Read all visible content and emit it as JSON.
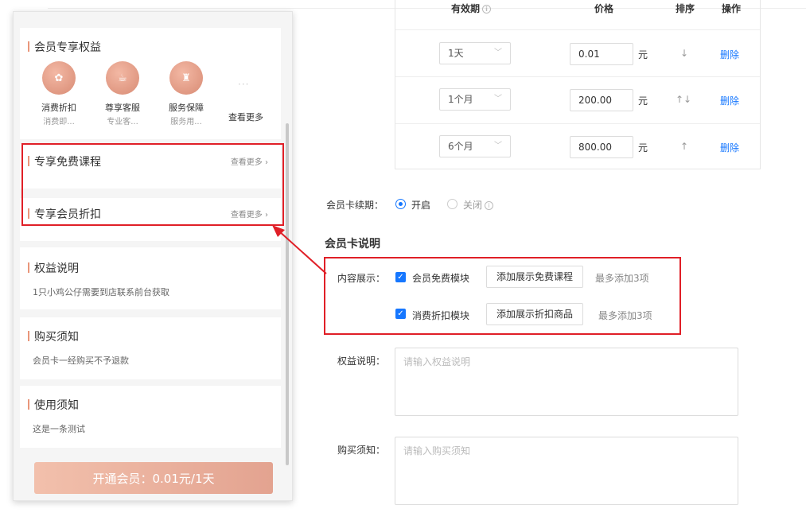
{
  "preview": {
    "benefits_title": "会员专享权益",
    "benefits": [
      {
        "icon": "discount-icon",
        "name": "消费折扣",
        "sub": "消费即..."
      },
      {
        "icon": "service-icon",
        "name": "尊享客服",
        "sub": "专业客..."
      },
      {
        "icon": "guarantee-icon",
        "name": "服务保障",
        "sub": "服务用..."
      }
    ],
    "benefits_more_dots": "···",
    "benefits_more": "查看更多",
    "free_course_title": "专享免费课程",
    "free_course_more": "查看更多 ›",
    "discount_title": "专享会员折扣",
    "discount_more": "查看更多 ›",
    "rights_title": "权益说明",
    "rights_text": "1只小鸡公仔需要到店联系前台获取",
    "purchase_title": "购买须知",
    "purchase_text": "会员卡一经购买不予退款",
    "usage_title": "使用须知",
    "usage_text": "这是一条测试",
    "join_button": "开通会员：0.01元/1天"
  },
  "table": {
    "headers": {
      "validity": "有效期",
      "price": "价格",
      "sort": "排序",
      "action": "操作"
    },
    "rows": [
      {
        "validity": "1天",
        "price": "0.01",
        "unit": "元",
        "sort": "↓",
        "action": "删除"
      },
      {
        "validity": "1个月",
        "price": "200.00",
        "unit": "元",
        "sort": "↑↓",
        "action": "删除"
      },
      {
        "validity": "6个月",
        "price": "800.00",
        "unit": "元",
        "sort": "↑",
        "action": "删除"
      }
    ]
  },
  "form": {
    "renew_label": "会员卡续期：",
    "renew_on": "开启",
    "renew_off": "关闭",
    "section_title": "会员卡说明",
    "content_label": "内容展示：",
    "module1_label": "会员免费模块",
    "module1_button": "添加展示免费课程",
    "module1_hint": "最多添加3项",
    "module2_label": "消费折扣模块",
    "module2_button": "添加展示折扣商品",
    "module2_hint": "最多添加3项",
    "rights_label": "权益说明：",
    "rights_placeholder": "请输入权益说明",
    "purchase_label": "购买须知：",
    "purchase_placeholder": "请输入购买须知"
  },
  "colors": {
    "accent": "#1677ff",
    "highlight": "#e01f27",
    "brand": "#e3a390"
  }
}
